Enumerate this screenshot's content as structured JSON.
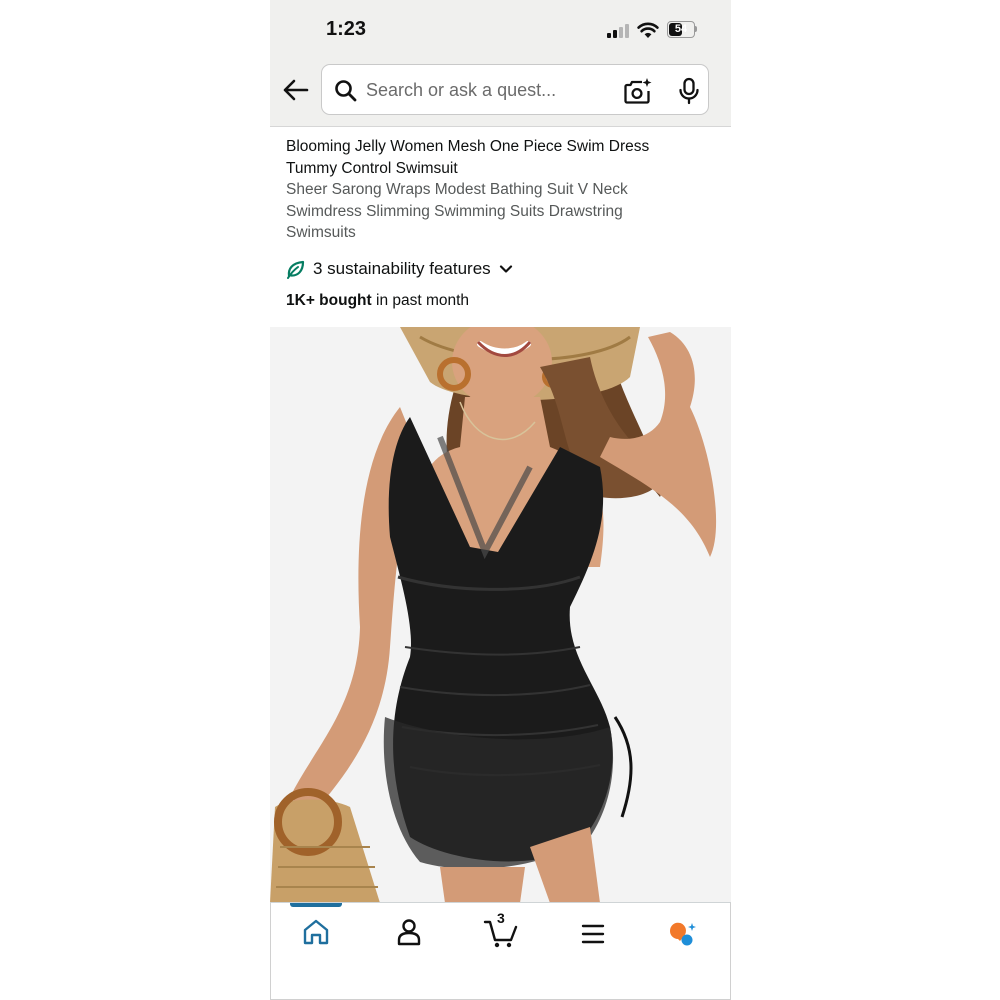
{
  "status_bar": {
    "time": "1:23",
    "battery": "54",
    "battery_level": 0.54
  },
  "search": {
    "placeholder": "Search or ask a quest..."
  },
  "product": {
    "title_line1": "Blooming Jelly Women Mesh One Piece Swim Dress",
    "title_line2": "Tummy Control Swimsuit",
    "subtitle_line1": "Sheer Sarong Wraps Modest Bathing Suit V Neck",
    "subtitle_line2": "Swimdress Slimming Swimming Suits Drawstring",
    "subtitle_line3": "Swimsuits",
    "sustainability": "3 sustainability features",
    "bought_count": "1K+ bought",
    "bought_suffix": " in past month"
  },
  "nav": {
    "cart_count": "3",
    "items": [
      "home-icon",
      "account-icon",
      "cart-icon",
      "menu-icon",
      "rufus-icon"
    ]
  },
  "colors": {
    "accent_blue": "#1f6f9e",
    "leaf_green": "#067d62",
    "assistant_orange": "#f2792a",
    "assistant_blue": "#1f8ed8"
  }
}
